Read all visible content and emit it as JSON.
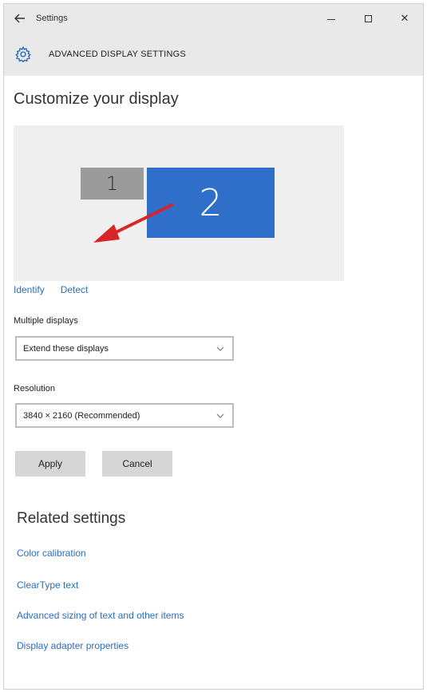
{
  "titlebar": {
    "back_icon": "back-arrow-icon",
    "title": "Settings",
    "minimize_icon": "minimize-icon",
    "maximize_icon": "maximize-icon",
    "close_glyph": "✕"
  },
  "header": {
    "icon": "gear-icon",
    "title": "ADVANCED DISPLAY SETTINGS",
    "accent": "#2a6ebb"
  },
  "main": {
    "page_title": "Customize your display",
    "monitors": [
      {
        "label": "1",
        "color": "#9b9b9b"
      },
      {
        "label": "2",
        "color": "#2f6fc9"
      }
    ],
    "annotation_arrow_color": "#d9252a",
    "links": {
      "identify": "Identify",
      "detect": "Detect"
    },
    "multiple_displays": {
      "label": "Multiple displays",
      "value": "Extend these displays"
    },
    "resolution": {
      "label": "Resolution",
      "value": "3840 × 2160 (Recommended)"
    },
    "buttons": {
      "apply": "Apply",
      "cancel": "Cancel"
    }
  },
  "related": {
    "title": "Related settings",
    "links": [
      "Color calibration",
      "ClearType text",
      "Advanced sizing of text and other items",
      "Display adapter properties"
    ]
  }
}
